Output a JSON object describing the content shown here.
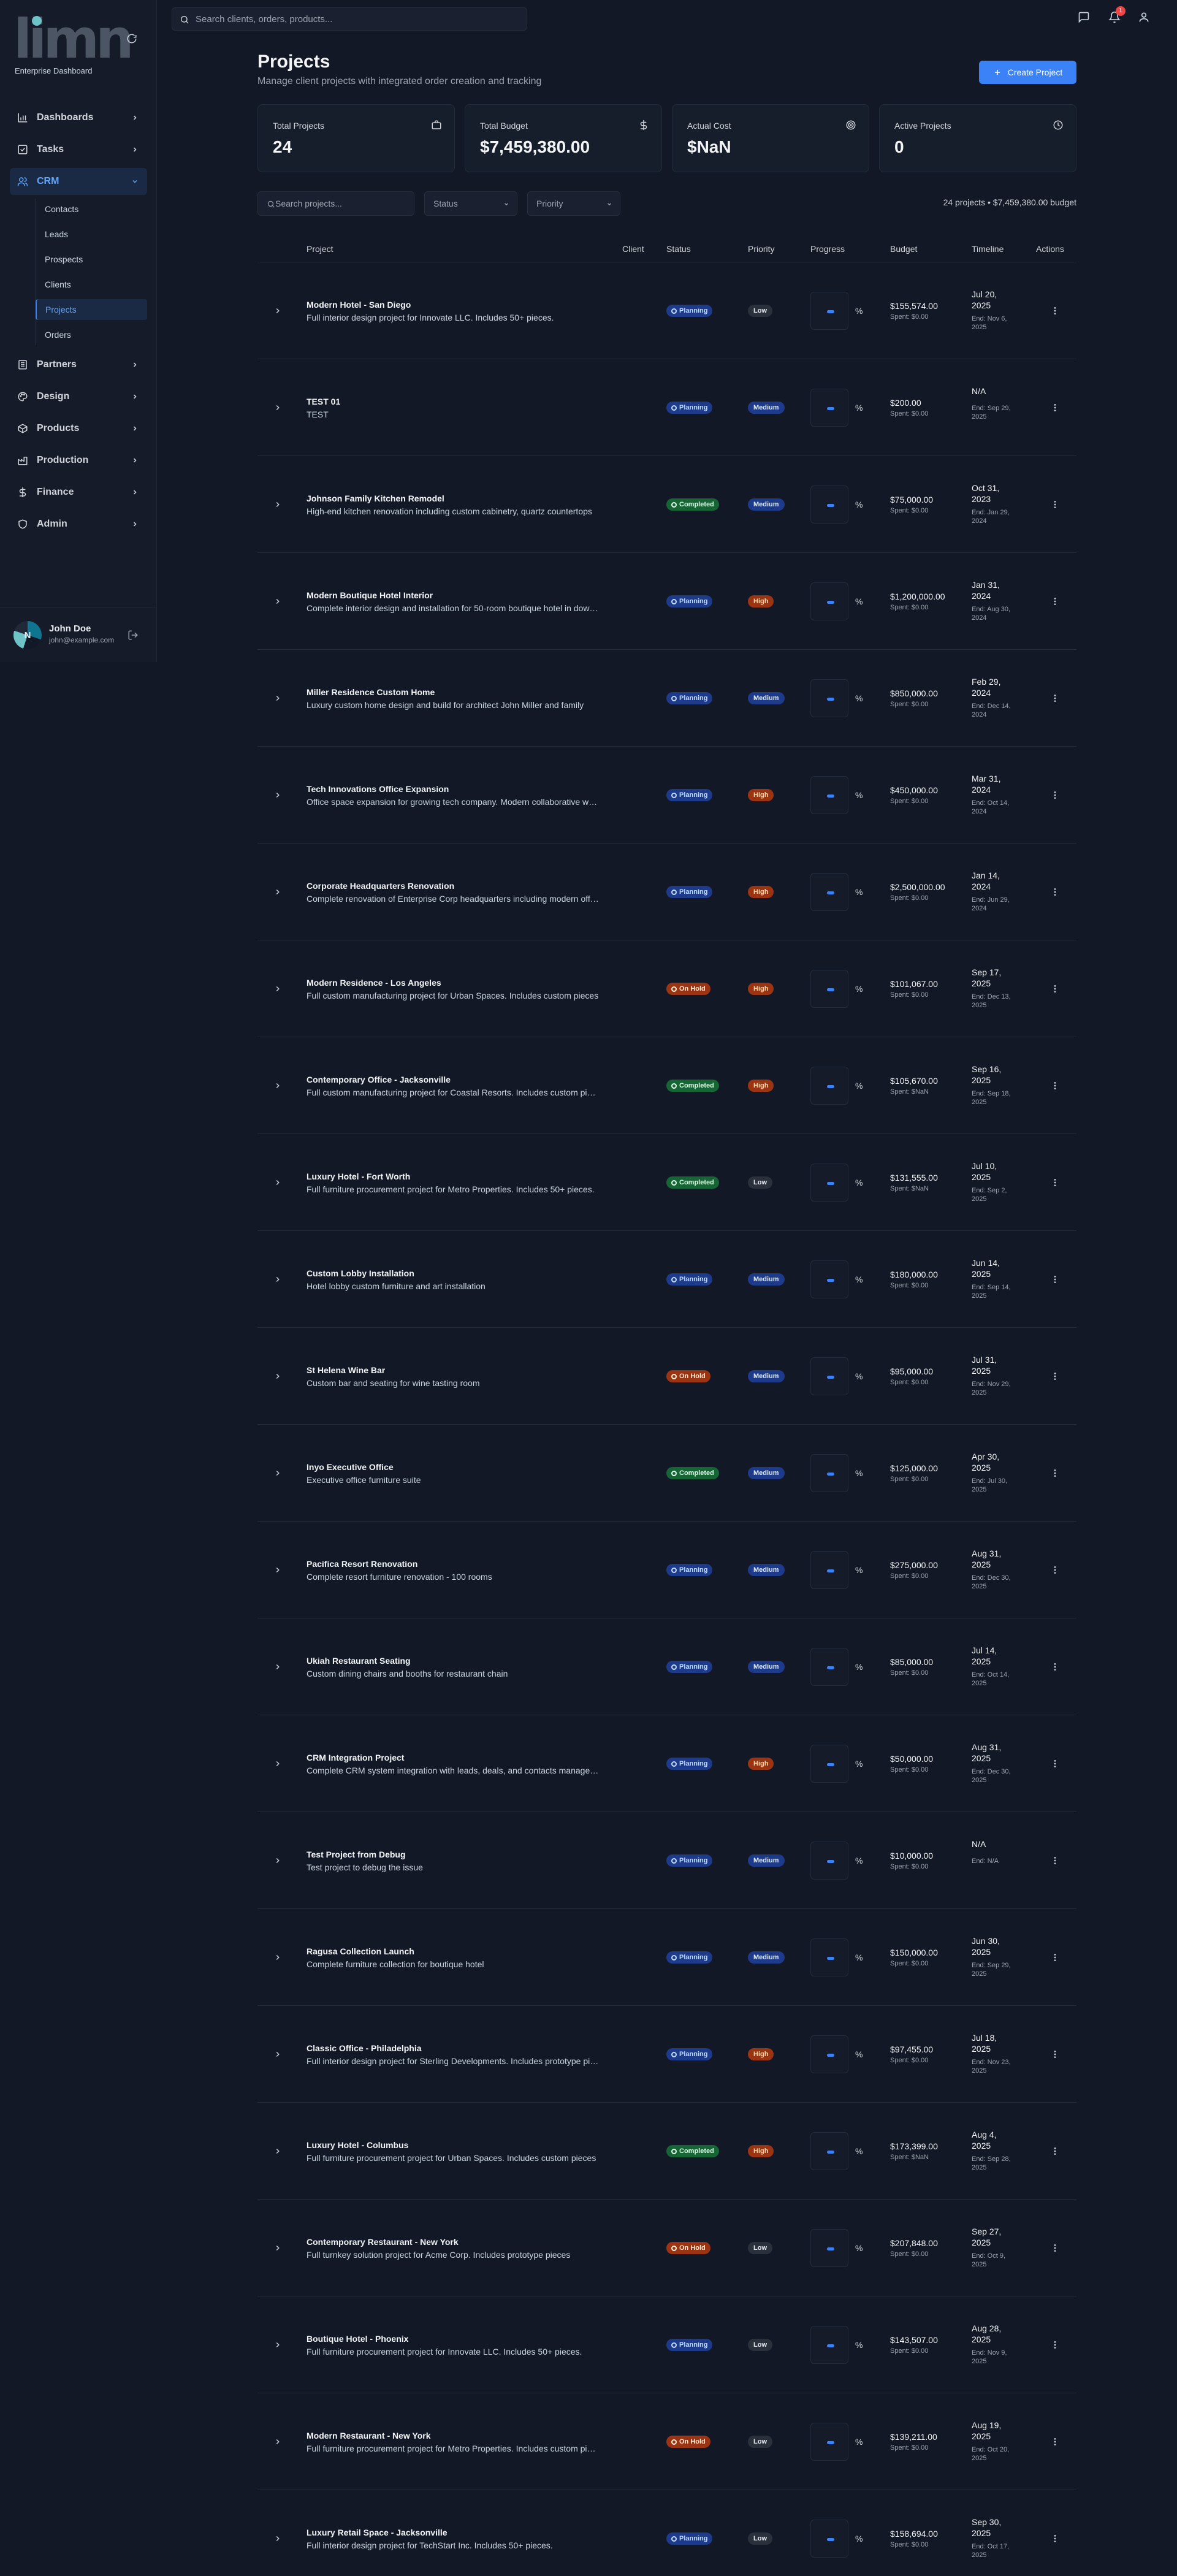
{
  "brand": {
    "logo_text": "limn",
    "subtitle": "Enterprise Dashboard"
  },
  "topbar": {
    "search_placeholder": "Search clients, orders, products...",
    "notification_count": "1"
  },
  "sidebar": {
    "items": [
      {
        "label": "Dashboards",
        "icon": "bar-chart-icon"
      },
      {
        "label": "Tasks",
        "icon": "checkbox-icon"
      },
      {
        "label": "CRM",
        "icon": "users-icon",
        "active": true,
        "children": [
          "Contacts",
          "Leads",
          "Prospects",
          "Clients",
          "Projects",
          "Orders"
        ],
        "active_child": "Projects"
      },
      {
        "label": "Partners",
        "icon": "building-icon"
      },
      {
        "label": "Design",
        "icon": "palette-icon"
      },
      {
        "label": "Products",
        "icon": "box-icon"
      },
      {
        "label": "Production",
        "icon": "factory-icon"
      },
      {
        "label": "Finance",
        "icon": "dollar-icon"
      },
      {
        "label": "Admin",
        "icon": "shield-icon"
      }
    ],
    "user": {
      "initial": "N",
      "name": "John Doe",
      "email": "john@example.com"
    }
  },
  "page": {
    "title": "Projects",
    "subtitle": "Manage client projects with integrated order creation and tracking",
    "create_label": "Create Project"
  },
  "stats": [
    {
      "label": "Total Projects",
      "value": "24",
      "icon": "briefcase-icon"
    },
    {
      "label": "Total Budget",
      "value": "$7,459,380.00",
      "icon": "dollar-icon"
    },
    {
      "label": "Actual Cost",
      "value": "$NaN",
      "icon": "target-icon"
    },
    {
      "label": "Active Projects",
      "value": "0",
      "icon": "clock-icon"
    }
  ],
  "filters": {
    "search_placeholder": "Search projects...",
    "status_label": "Status",
    "priority_label": "Priority",
    "summary": "24 projects • $7,459,380.00 budget"
  },
  "table": {
    "columns": [
      "Project",
      "Client",
      "Status",
      "Priority",
      "Progress",
      "Budget",
      "Timeline",
      "Actions"
    ],
    "rows": [
      {
        "name": "Modern Hotel - San Diego",
        "desc": "Full interior design project for Innovate LLC. Includes 50+ pieces.",
        "status": "Planning",
        "priority": "Low",
        "budget": "$155,574.00",
        "spent": "Spent: $0.00",
        "start": "Jul 20, 2025",
        "end": "End: Nov 6, 2025"
      },
      {
        "name": "TEST 01",
        "desc": "TEST",
        "status": "Planning",
        "priority": "Medium",
        "budget": "$200.00",
        "spent": "Spent: $0.00",
        "start": "N/A",
        "end": "End: Sep 29, 2025"
      },
      {
        "name": "Johnson Family Kitchen Remodel",
        "desc": "High-end kitchen renovation including custom cabinetry, quartz countertops",
        "status": "Completed",
        "priority": "Medium",
        "budget": "$75,000.00",
        "spent": "Spent: $0.00",
        "start": "Oct 31, 2023",
        "end": "End: Jan 29, 2024"
      },
      {
        "name": "Modern Boutique Hotel Interior",
        "desc": "Complete interior design and installation for 50-room boutique hotel in downtown",
        "status": "Planning",
        "priority": "High",
        "budget": "$1,200,000.00",
        "spent": "Spent: $0.00",
        "start": "Jan 31, 2024",
        "end": "End: Aug 30, 2024"
      },
      {
        "name": "Miller Residence Custom Home",
        "desc": "Luxury custom home design and build for architect John Miller and family",
        "status": "Planning",
        "priority": "Medium",
        "budget": "$850,000.00",
        "spent": "Spent: $0.00",
        "start": "Feb 29, 2024",
        "end": "End: Dec 14, 2024"
      },
      {
        "name": "Tech Innovations Office Expansion",
        "desc": "Office space expansion for growing tech company. Modern collaborative workspace",
        "status": "Planning",
        "priority": "High",
        "budget": "$450,000.00",
        "spent": "Spent: $0.00",
        "start": "Mar 31, 2024",
        "end": "End: Oct 14, 2024"
      },
      {
        "name": "Corporate Headquarters Renovation",
        "desc": "Complete renovation of Enterprise Corp headquarters including modern offices",
        "status": "Planning",
        "priority": "High",
        "budget": "$2,500,000.00",
        "spent": "Spent: $0.00",
        "start": "Jan 14, 2024",
        "end": "End: Jun 29, 2024"
      },
      {
        "name": "Modern Residence - Los Angeles",
        "desc": "Full custom manufacturing project for Urban Spaces. Includes custom pieces",
        "status": "On Hold",
        "priority": "High",
        "budget": "$101,067.00",
        "spent": "Spent: $0.00",
        "start": "Sep 17, 2025",
        "end": "End: Dec 13, 2025"
      },
      {
        "name": "Contemporary Office - Jacksonville",
        "desc": "Full custom manufacturing project for Coastal Resorts. Includes custom pieces",
        "status": "Completed",
        "priority": "High",
        "budget": "$105,670.00",
        "spent": "Spent: $NaN",
        "start": "Sep 16, 2025",
        "end": "End: Sep 18, 2025"
      },
      {
        "name": "Luxury Hotel - Fort Worth",
        "desc": "Full furniture procurement project for Metro Properties. Includes 50+ pieces.",
        "status": "Completed",
        "priority": "Low",
        "budget": "$131,555.00",
        "spent": "Spent: $NaN",
        "start": "Jul 10, 2025",
        "end": "End: Sep 2, 2025"
      },
      {
        "name": "Custom Lobby Installation",
        "desc": "Hotel lobby custom furniture and art installation",
        "status": "Planning",
        "priority": "Medium",
        "budget": "$180,000.00",
        "spent": "Spent: $0.00",
        "start": "Jun 14, 2025",
        "end": "End: Sep 14, 2025"
      },
      {
        "name": "St Helena Wine Bar",
        "desc": "Custom bar and seating for wine tasting room",
        "status": "On Hold",
        "priority": "Medium",
        "budget": "$95,000.00",
        "spent": "Spent: $0.00",
        "start": "Jul 31, 2025",
        "end": "End: Nov 29, 2025"
      },
      {
        "name": "Inyo Executive Office",
        "desc": "Executive office furniture suite",
        "status": "Completed",
        "priority": "Medium",
        "budget": "$125,000.00",
        "spent": "Spent: $0.00",
        "start": "Apr 30, 2025",
        "end": "End: Jul 30, 2025"
      },
      {
        "name": "Pacifica Resort Renovation",
        "desc": "Complete resort furniture renovation - 100 rooms",
        "status": "Planning",
        "priority": "Medium",
        "budget": "$275,000.00",
        "spent": "Spent: $0.00",
        "start": "Aug 31, 2025",
        "end": "End: Dec 30, 2025"
      },
      {
        "name": "Ukiah Restaurant Seating",
        "desc": "Custom dining chairs and booths for restaurant chain",
        "status": "Planning",
        "priority": "Medium",
        "budget": "$85,000.00",
        "spent": "Spent: $0.00",
        "start": "Jul 14, 2025",
        "end": "End: Oct 14, 2025"
      },
      {
        "name": "CRM Integration Project",
        "desc": "Complete CRM system integration with leads, deals, and contacts management",
        "status": "Planning",
        "priority": "High",
        "budget": "$50,000.00",
        "spent": "Spent: $0.00",
        "start": "Aug 31, 2025",
        "end": "End: Dec 30, 2025"
      },
      {
        "name": "Test Project from Debug",
        "desc": "Test project to debug the issue",
        "status": "Planning",
        "priority": "Medium",
        "budget": "$10,000.00",
        "spent": "Spent: $0.00",
        "start": "N/A",
        "end": "End: N/A"
      },
      {
        "name": "Ragusa Collection Launch",
        "desc": "Complete furniture collection for boutique hotel",
        "status": "Planning",
        "priority": "Medium",
        "budget": "$150,000.00",
        "spent": "Spent: $0.00",
        "start": "Jun 30, 2025",
        "end": "End: Sep 29, 2025"
      },
      {
        "name": "Classic Office - Philadelphia",
        "desc": "Full interior design project for Sterling Developments. Includes prototype pieces",
        "status": "Planning",
        "priority": "High",
        "budget": "$97,455.00",
        "spent": "Spent: $0.00",
        "start": "Jul 18, 2025",
        "end": "End: Nov 23, 2025"
      },
      {
        "name": "Luxury Hotel - Columbus",
        "desc": "Full furniture procurement project for Urban Spaces. Includes custom pieces",
        "status": "Completed",
        "priority": "High",
        "budget": "$173,399.00",
        "spent": "Spent: $NaN",
        "start": "Aug 4, 2025",
        "end": "End: Sep 28, 2025"
      },
      {
        "name": "Contemporary Restaurant - New York",
        "desc": "Full turnkey solution project for Acme Corp. Includes prototype pieces",
        "status": "On Hold",
        "priority": "Low",
        "budget": "$207,848.00",
        "spent": "Spent: $0.00",
        "start": "Sep 27, 2025",
        "end": "End: Oct 9, 2025"
      },
      {
        "name": "Boutique Hotel - Phoenix",
        "desc": "Full furniture procurement project for Innovate LLC. Includes 50+ pieces.",
        "status": "Planning",
        "priority": "Low",
        "budget": "$143,507.00",
        "spent": "Spent: $0.00",
        "start": "Aug 28, 2025",
        "end": "End: Nov 9, 2025"
      },
      {
        "name": "Modern Restaurant - New York",
        "desc": "Full furniture procurement project for Metro Properties. Includes custom pieces",
        "status": "On Hold",
        "priority": "Low",
        "budget": "$139,211.00",
        "spent": "Spent: $0.00",
        "start": "Aug 19, 2025",
        "end": "End: Oct 20, 2025"
      },
      {
        "name": "Luxury Retail Space - Jacksonville",
        "desc": "Full interior design project for TechStart Inc. Includes 50+ pieces.",
        "status": "Planning",
        "priority": "Low",
        "budget": "$158,694.00",
        "spent": "Spent: $0.00",
        "start": "Sep 30, 2025",
        "end": "End: Oct 17, 2025"
      }
    ],
    "progress_suffix": "%"
  },
  "colors": {
    "accent": "#3b82f6",
    "background": "#121826",
    "planning": "#1e3a8a",
    "completed": "#166534",
    "on_hold": "#9a3412"
  }
}
